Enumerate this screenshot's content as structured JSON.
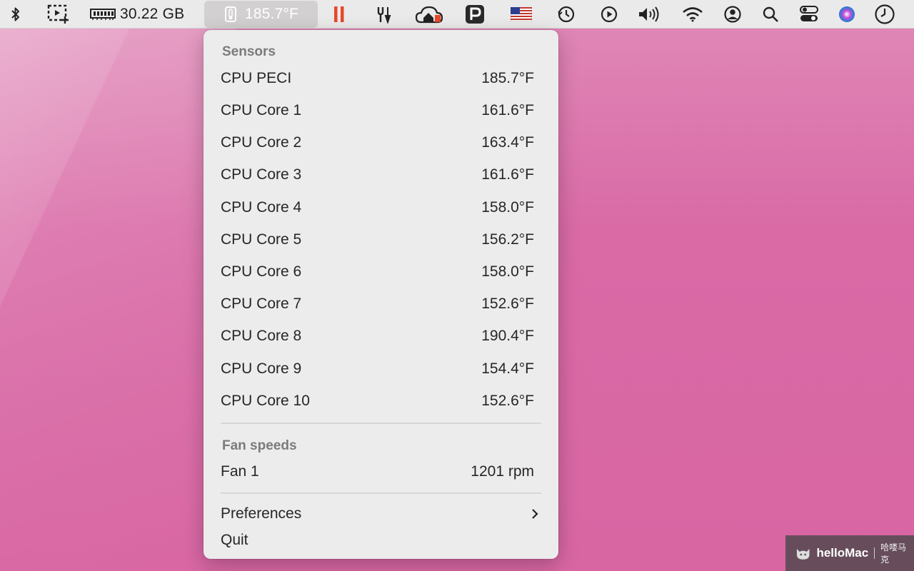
{
  "menubar": {
    "memory_value": "30.22 GB",
    "temperature_value": "185.7°F",
    "icons": [
      "bluetooth-icon",
      "screenshot-icon",
      "memory-icon",
      "thermometer-icon",
      "pause-icon",
      "tools-icon",
      "cloud-home-icon",
      "parking-icon",
      "us-flag-icon",
      "time-machine-icon",
      "play-icon",
      "volume-icon",
      "wifi-icon",
      "user-icon",
      "search-icon",
      "control-center-icon",
      "siri-icon",
      "clock-icon"
    ]
  },
  "menu": {
    "sensors_header": "Sensors",
    "sensors": [
      {
        "label": "CPU PECI",
        "value": "185.7°F"
      },
      {
        "label": "CPU Core 1",
        "value": "161.6°F"
      },
      {
        "label": "CPU Core 2",
        "value": "163.4°F"
      },
      {
        "label": "CPU Core 3",
        "value": "161.6°F"
      },
      {
        "label": "CPU Core 4",
        "value": "158.0°F"
      },
      {
        "label": "CPU Core 5",
        "value": "156.2°F"
      },
      {
        "label": "CPU Core 6",
        "value": "158.0°F"
      },
      {
        "label": "CPU Core 7",
        "value": "152.6°F"
      },
      {
        "label": "CPU Core 8",
        "value": "190.4°F"
      },
      {
        "label": "CPU Core 9",
        "value": "154.4°F"
      },
      {
        "label": "CPU Core 10",
        "value": "152.6°F"
      }
    ],
    "fans_header": "Fan speeds",
    "fans": [
      {
        "label": "Fan 1",
        "value": "1201 rpm"
      }
    ],
    "preferences_label": "Preferences",
    "quit_label": "Quit"
  },
  "watermark": {
    "brand": "helloMac",
    "cn": "哈喽马克"
  },
  "colors": {
    "desktop": "#d965a2",
    "menubar": "#ebeaea",
    "menu_bg": "#ececec",
    "accent_red": "#e8472a"
  }
}
